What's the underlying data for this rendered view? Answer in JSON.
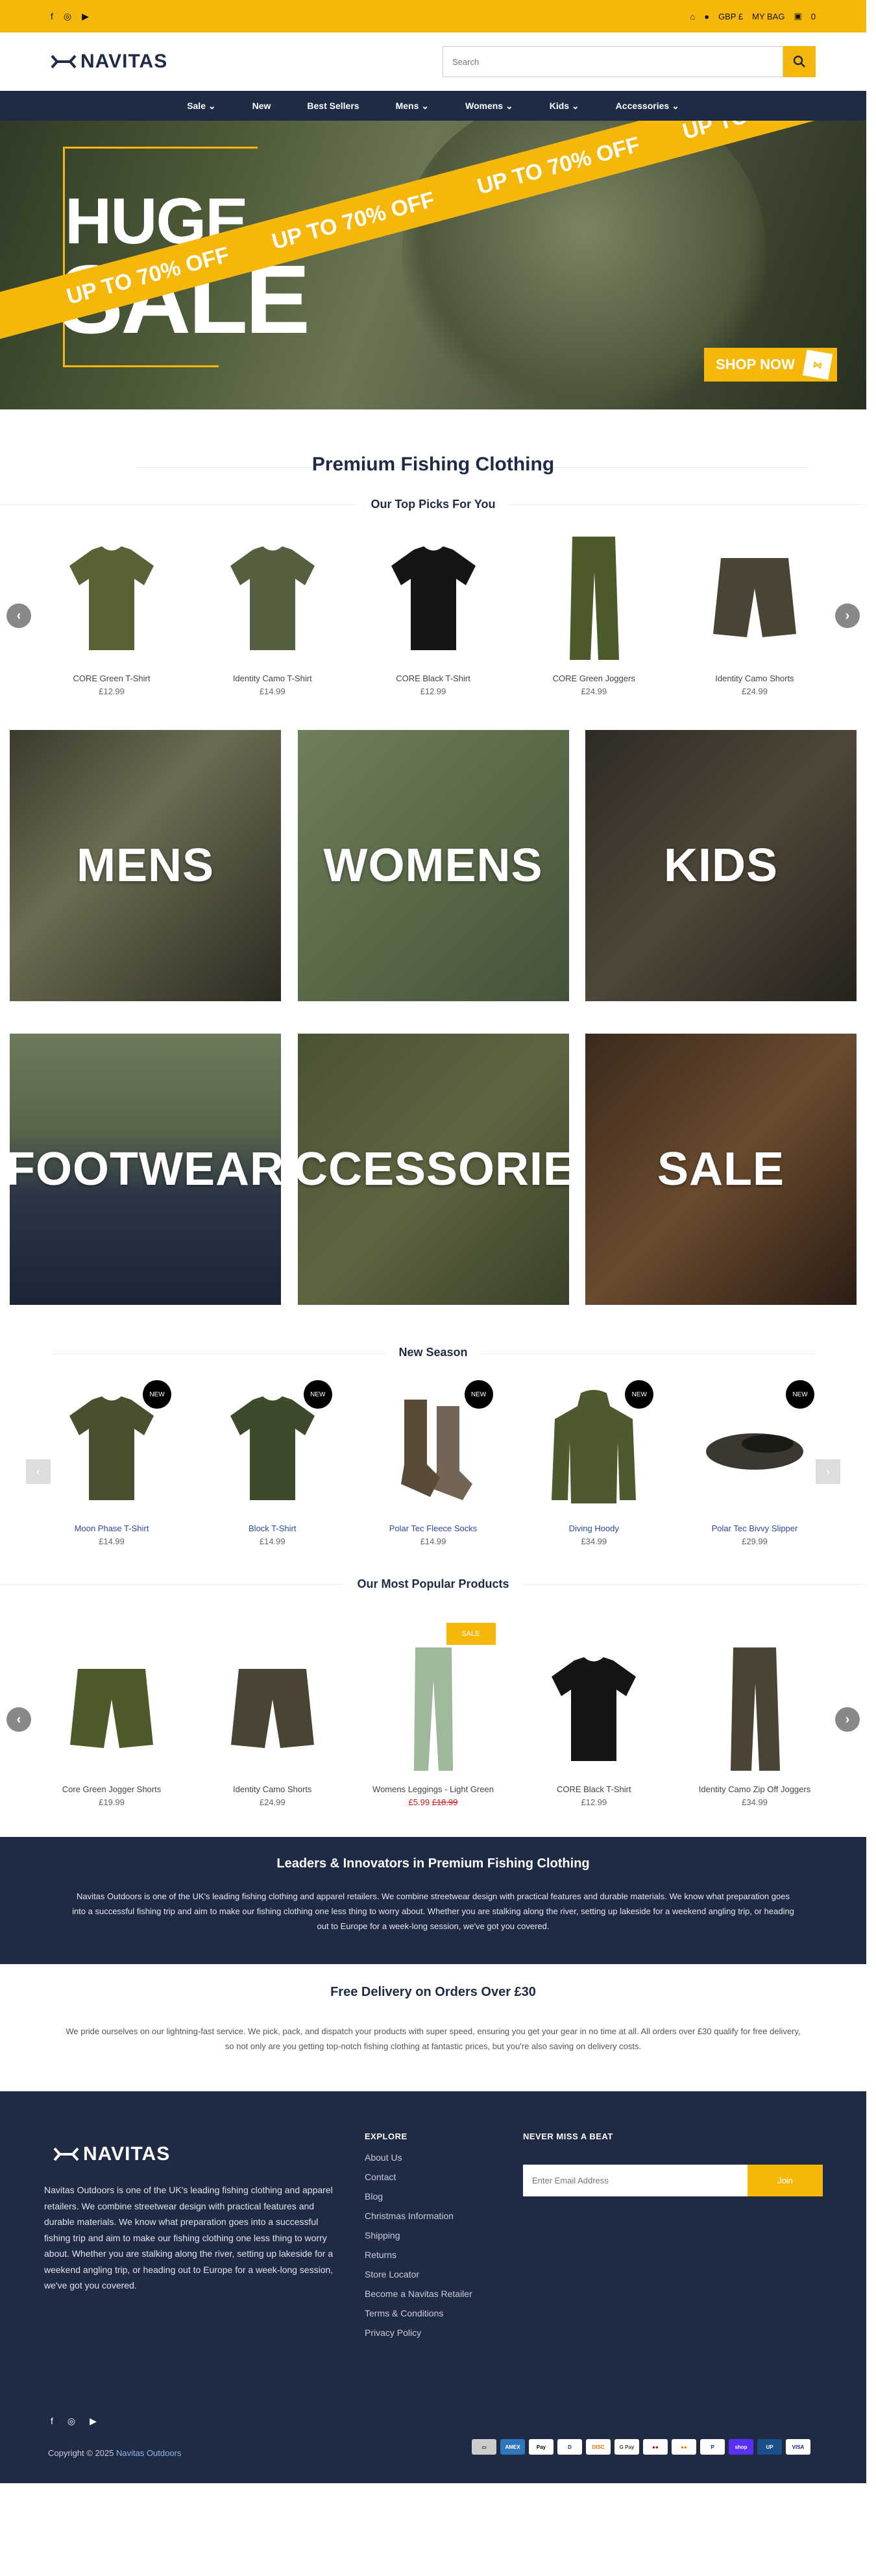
{
  "colors": {
    "accent": "#f5b80a",
    "navy": "#1f2a44",
    "sale_red": "#d11a1a"
  },
  "topbar": {
    "icons": [
      "facebook-icon",
      "instagram-icon",
      "youtube-icon"
    ],
    "currency": "GBP £",
    "bag": "MY BAG",
    "bag_count": "0"
  },
  "header": {
    "logo": "NAVITAS",
    "search_placeholder": "Search"
  },
  "nav": [
    {
      "label": "Sale ⌄"
    },
    {
      "label": "New"
    },
    {
      "label": "Best Sellers"
    },
    {
      "label": "Mens ⌄"
    },
    {
      "label": "Womens ⌄"
    },
    {
      "label": "Kids ⌄"
    },
    {
      "label": "Accessories ⌄"
    }
  ],
  "hero": {
    "line1": "HUGE",
    "line2": "SALE",
    "band_text": "UP TO 70% OFF",
    "cta": "SHOP NOW"
  },
  "premium": {
    "title": "Premium Fishing Clothing",
    "picks_title": "Our Top Picks For You"
  },
  "picks": [
    {
      "name": "CORE Green T-Shirt",
      "price": "£12.99",
      "color": "#5a6135",
      "shape": "tee"
    },
    {
      "name": "Identity Camo T-Shirt",
      "price": "£14.99",
      "color": "#556040",
      "shape": "tee"
    },
    {
      "name": "CORE Black T-Shirt",
      "price": "£12.99",
      "color": "#151515",
      "shape": "tee"
    },
    {
      "name": "CORE Green Joggers",
      "price": "£24.99",
      "color": "#4c5a2a",
      "shape": "pants"
    },
    {
      "name": "Identity Camo Shorts",
      "price": "£24.99",
      "color": "#4a4434",
      "shape": "shorts"
    }
  ],
  "tiles": [
    {
      "label": "MENS",
      "bg": "linear-gradient(135deg,#3c3a2c,#6b6c52 40%,#2b2a20)"
    },
    {
      "label": "WOMENS",
      "bg": "linear-gradient(135deg,#6f7f5d,#5a6a48 50%,#44523a)"
    },
    {
      "label": "KIDS",
      "bg": "linear-gradient(135deg,#2f2b24,#4e4637 50%,#26221c)"
    },
    {
      "label": "FOOTWEAR",
      "bg": "linear-gradient(180deg,#6d7a5a 0%,#5a6648 35%,#2a3548 60%,#1c2535 100%)"
    },
    {
      "label": "ACCESSORIES",
      "bg": "linear-gradient(135deg,#4a5234,#5d6542 50%,#3a4128)"
    },
    {
      "label": "SALE",
      "bg": "linear-gradient(135deg,#3b2a1c,#6a4a2e 50%,#2b1e14)"
    }
  ],
  "new_season": {
    "title": "New Season",
    "badge": "NEW",
    "items": [
      {
        "name": "Moon Phase T-Shirt",
        "price": "£14.99",
        "color": "#4b4f30",
        "shape": "tee"
      },
      {
        "name": "Block T-Shirt",
        "price": "£14.99",
        "color": "#3e4a2c",
        "shape": "tee"
      },
      {
        "name": "Polar Tec Fleece Socks",
        "price": "£14.99",
        "color": "#5a4a38",
        "shape": "socks"
      },
      {
        "name": "Diving Hoody",
        "price": "£34.99",
        "color": "#4e5a2e",
        "shape": "hoody"
      },
      {
        "name": "Polar Tec Bivvy Slipper",
        "price": "£29.99",
        "color": "#3a3830",
        "shape": "slipper"
      }
    ]
  },
  "popular": {
    "title": "Our Most Popular Products",
    "sale_badge": "SALE",
    "items": [
      {
        "name": "Core Green Jogger Shorts",
        "price": "£19.99",
        "old_price": "",
        "color": "#4e5a2a",
        "shape": "shorts"
      },
      {
        "name": "Identity Camo Shorts",
        "price": "£24.99",
        "old_price": "",
        "color": "#4a4434",
        "shape": "shorts"
      },
      {
        "name": "Womens Leggings - Light Green",
        "price": "£5.99",
        "old_price": "£18.99",
        "color": "#9fb79a",
        "shape": "leggings"
      },
      {
        "name": "CORE Black T-Shirt",
        "price": "£12.99",
        "old_price": "",
        "color": "#151515",
        "shape": "tee"
      },
      {
        "name": "Identity Camo Zip Off Joggers",
        "price": "£34.99",
        "old_price": "",
        "color": "#4a4434",
        "shape": "pants"
      }
    ]
  },
  "leaders": {
    "title": "Leaders & Innovators in Premium Fishing Clothing",
    "text": "Navitas Outdoors is one of the UK's leading fishing clothing and apparel retailers. We combine streetwear design with practical features and durable materials. We know what preparation goes into a successful fishing trip and aim to make our fishing clothing one less thing to worry about. Whether you are stalking along the river, setting up lakeside for a weekend angling trip, or heading out to Europe for a week-long session, we've got you covered."
  },
  "delivery": {
    "title": "Free Delivery on Orders Over £30",
    "text": "We pride ourselves on our lightning-fast service. We pick, pack, and dispatch your products with super speed, ensuring you get your gear in no time at all. All orders over £30 qualify for free delivery, so not only are you getting top-notch fishing clothing at fantastic prices, but you're also saving on delivery costs."
  },
  "footer": {
    "logo": "NAVITAS",
    "about": "Navitas Outdoors is one of the UK's leading fishing clothing and apparel retailers. We combine streetwear design with practical features and durable materials. We know what preparation goes into a successful fishing trip and aim to make our fishing clothing one less thing to worry about. Whether you are stalking along the river, setting up lakeside for a weekend angling trip, or heading out to Europe for a week-long session, we've got you covered.",
    "explore_title": "EXPLORE",
    "links": [
      "About Us",
      "Contact",
      "Blog",
      "Christmas Information",
      "Shipping",
      "Returns",
      "Store Locator",
      "Become a Navitas Retailer",
      "Terms & Conditions",
      "Privacy Policy"
    ],
    "newsletter_title": "NEVER MISS A BEAT",
    "email_placeholder": "Enter Email Address",
    "join": "Join",
    "copyright": "Copyright © 2025",
    "copyright_brand": "Navitas Outdoors",
    "payments": [
      {
        "label": "▭",
        "bg": "#ccc",
        "fg": "#333"
      },
      {
        "label": "AMEX",
        "bg": "#2e77bc",
        "fg": "#fff"
      },
      {
        "label": "Pay",
        "bg": "#fff",
        "fg": "#000"
      },
      {
        "label": "D",
        "bg": "#fff",
        "fg": "#0a3d91"
      },
      {
        "label": "DISC",
        "bg": "#fff",
        "fg": "#e8720c"
      },
      {
        "label": "G Pay",
        "bg": "#fff",
        "fg": "#444"
      },
      {
        "label": "●●",
        "bg": "#fff",
        "fg": "#d0021b"
      },
      {
        "label": "●●",
        "bg": "#fff",
        "fg": "#eb7900"
      },
      {
        "label": "P",
        "bg": "#fff",
        "fg": "#003087"
      },
      {
        "label": "shop",
        "bg": "#5a31f4",
        "fg": "#fff"
      },
      {
        "label": "UP",
        "bg": "#1a4f8b",
        "fg": "#fff"
      },
      {
        "label": "VISA",
        "bg": "#fff",
        "fg": "#1a1f71"
      }
    ]
  }
}
